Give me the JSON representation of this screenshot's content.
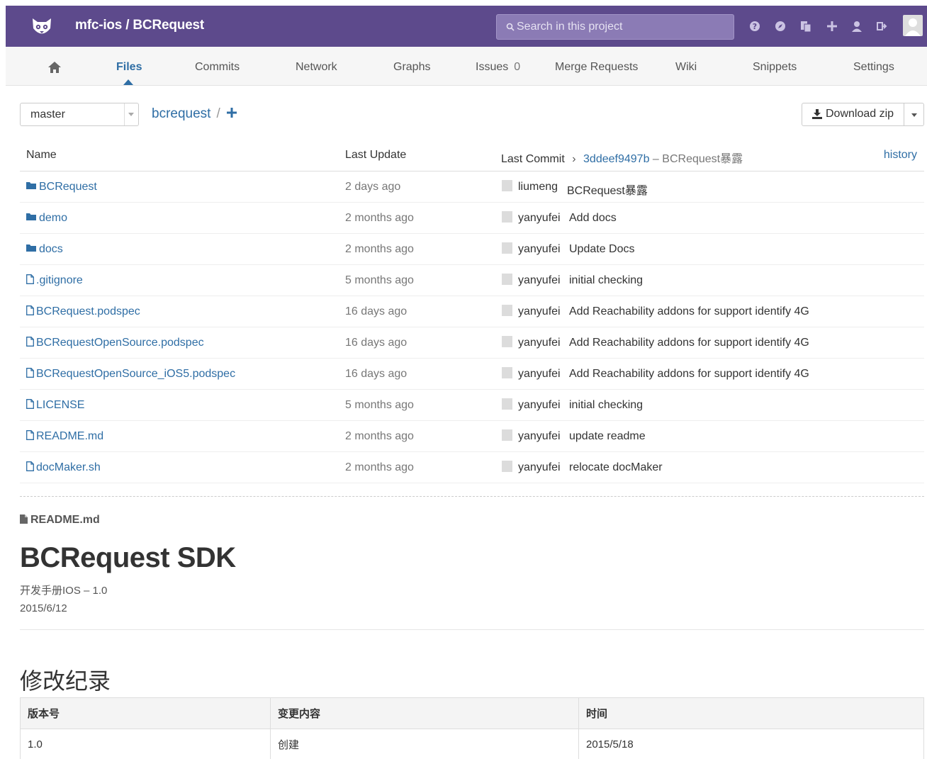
{
  "header": {
    "project_title": "mfc-ios / BCRequest",
    "search_placeholder": "Search in this project",
    "icons": [
      "help-icon",
      "explore-icon",
      "copy-icon",
      "plus-icon",
      "user-icon",
      "signout-icon"
    ],
    "colors": {
      "header_bg": "#5d4a8c",
      "link": "#2f6ea5"
    }
  },
  "nav": {
    "tabs": [
      {
        "label": "Files",
        "active": true
      },
      {
        "label": "Commits"
      },
      {
        "label": "Network"
      },
      {
        "label": "Graphs"
      },
      {
        "label": "Issues",
        "count": "0"
      },
      {
        "label": "Merge Requests"
      },
      {
        "label": "Wiki"
      },
      {
        "label": "Snippets"
      },
      {
        "label": "Settings"
      }
    ]
  },
  "toolbar": {
    "branch": "master",
    "path": "bcrequest",
    "path_sep": "/",
    "download_label": "Download zip"
  },
  "file_table": {
    "headers": {
      "name": "Name",
      "last_update": "Last Update",
      "last_commit": "Last Commit",
      "commit_sha": "3ddeef9497b",
      "commit_dash": "–",
      "commit_msg": "BCRequest暴露",
      "history": "history"
    },
    "rows": [
      {
        "name": "BCRequest",
        "type": "folder",
        "updated": "2 days ago",
        "author": "liumeng",
        "message": "BCRequest暴露"
      },
      {
        "name": "demo",
        "type": "folder",
        "updated": "2 months ago",
        "author": "yanyufei",
        "message": "Add docs"
      },
      {
        "name": "docs",
        "type": "folder",
        "updated": "2 months ago",
        "author": "yanyufei",
        "message": "Update Docs"
      },
      {
        "name": ".gitignore",
        "type": "file",
        "updated": "5 months ago",
        "author": "yanyufei",
        "message": "initial checking"
      },
      {
        "name": "BCRequest.podspec",
        "type": "file",
        "updated": "16 days ago",
        "author": "yanyufei",
        "message": "Add Reachability addons for support identify 4G"
      },
      {
        "name": "BCRequestOpenSource.podspec",
        "type": "file",
        "updated": "16 days ago",
        "author": "yanyufei",
        "message": "Add Reachability addons for support identify 4G"
      },
      {
        "name": "BCRequestOpenSource_iOS5.podspec",
        "type": "file",
        "updated": "16 days ago",
        "author": "yanyufei",
        "message": "Add Reachability addons for support identify 4G"
      },
      {
        "name": "LICENSE",
        "type": "file",
        "updated": "5 months ago",
        "author": "yanyufei",
        "message": "initial checking"
      },
      {
        "name": "README.md",
        "type": "file",
        "updated": "2 months ago",
        "author": "yanyufei",
        "message": "update readme"
      },
      {
        "name": "docMaker.sh",
        "type": "file",
        "updated": "2 months ago",
        "author": "yanyufei",
        "message": "relocate docMaker"
      }
    ]
  },
  "readme": {
    "file_label": "README.md",
    "title": "BCRequest SDK",
    "subtitle": "开发手册IOS – 1.0",
    "date": "2015/6/12",
    "section_title": "修改纪录",
    "table": {
      "headers": [
        "版本号",
        "变更内容",
        "时间"
      ],
      "rows": [
        [
          "1.0",
          "创建",
          "2015/5/18"
        ]
      ]
    }
  }
}
